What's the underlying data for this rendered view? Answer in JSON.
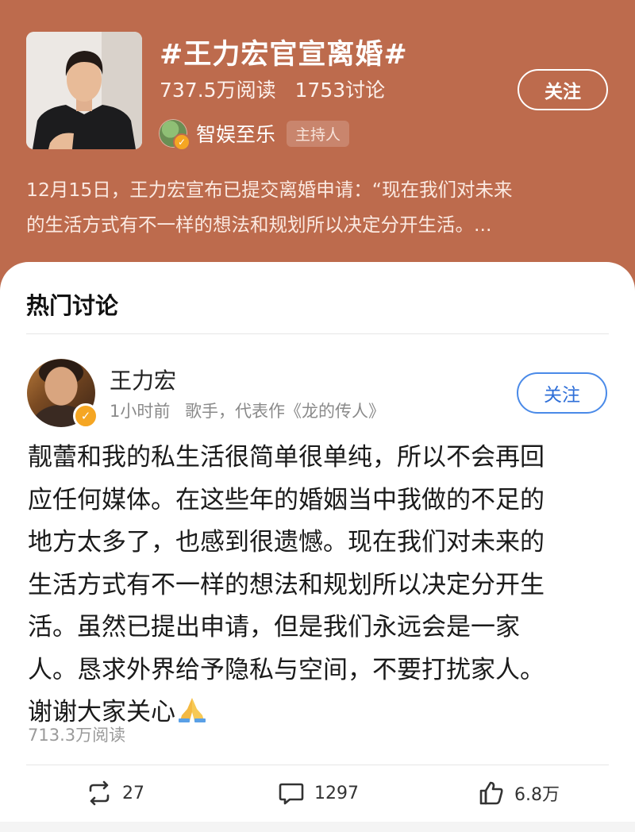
{
  "topic": {
    "title": "#王力宏官宣离婚#",
    "reads": "737.5万阅读",
    "discussions": "1753讨论",
    "host_name": "智娱至乐",
    "host_tag": "主持人",
    "follow_label": "关注",
    "description_lines": [
      "12月15日，王力宏宣布已提交离婚申请：“现在我们对未来",
      "的生活方式有不一样的想法和规划所以决定分开生活。..."
    ]
  },
  "hot": {
    "section_title": "热门讨论"
  },
  "post": {
    "author": "王力宏",
    "time": "1小时前",
    "bio": "歌手，代表作《龙的传人》",
    "follow_label": "关注",
    "body_lines": [
      "靓蕾和我的私生活很简单很单纯，所以不会再回",
      "应任何媒体。在这些年的婚姻当中我做的不足的",
      "地方太多了，也感到很遗憾。现在我们对未来的",
      "生活方式有不一样的想法和规划所以决定分开生",
      "活。虽然已提出申请，但是我们永远会是一家",
      "人。恳求外界给予隐私与空间，不要打扰家人。",
      "谢谢大家关心"
    ],
    "reads": "713.3万阅读",
    "reposts": "27",
    "comments": "1297",
    "likes": "6.8万"
  },
  "icons": {
    "verified": "verified-badge-icon",
    "pray": "praying-hands-emoji",
    "repost": "repost-icon",
    "comment": "comment-icon",
    "like": "thumbs-up-icon"
  },
  "colors": {
    "header_bg": "#bd6b4d",
    "follow_blue": "#2f6fd8",
    "verified": "#f5a623"
  }
}
